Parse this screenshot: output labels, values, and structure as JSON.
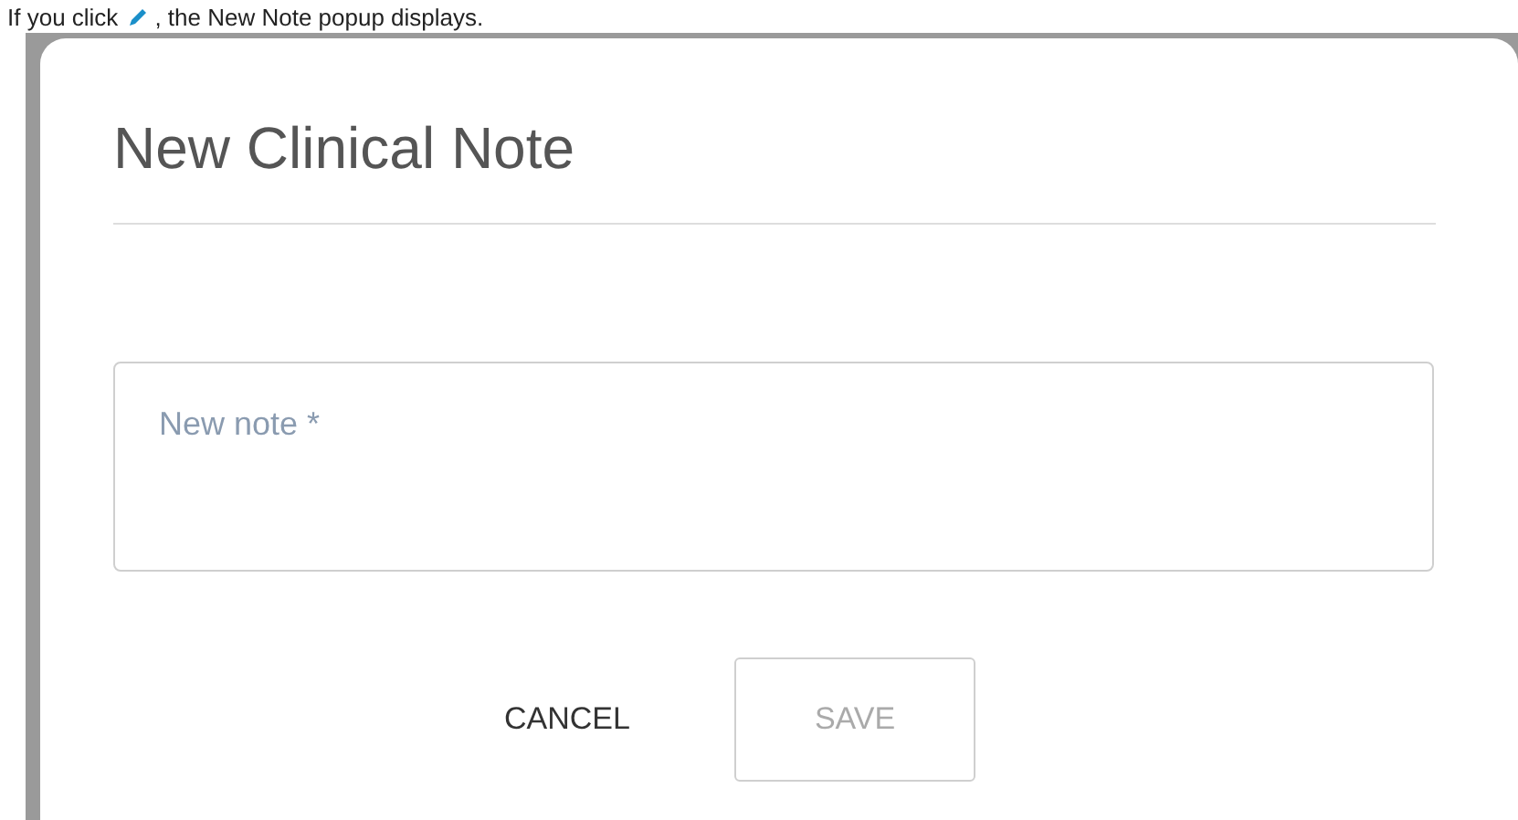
{
  "caption": {
    "before_icon": "If you click",
    "after_icon": ", the New Note popup displays."
  },
  "dialog": {
    "title": "New Clinical Note",
    "note_field": {
      "placeholder": "New note *"
    },
    "buttons": [
      {
        "label": "CANCEL",
        "kind": "text",
        "disabled": false
      },
      {
        "label": "SAVE",
        "kind": "outlined",
        "disabled": true
      }
    ]
  }
}
